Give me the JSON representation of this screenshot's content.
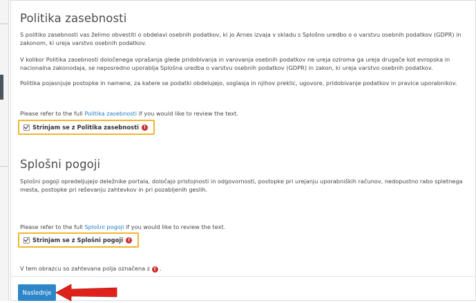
{
  "privacy": {
    "title": "Politika zasebnosti",
    "para1": "S politiko zasebnosti vas želimo obvestiti o obdelavi osebnih podatkov, ki jo Arnes izvaja v skladu s Splošno uredbo o o varstvu osebnih podatkov (GDPR) in zakonom, ki ureja varstvo osebnih podatkov.",
    "para2": "V kolikor Politika zasebnosti določenega vprašanja glede pridobivanja in varovanja osebnih podatkov ne ureja oziroma ga ureja drugače kot evropska in nacionalna zakonodaja, se neposredno uporablja Splošna uredba o varstvu osebnih podatkov (GDPR) in zakon, ki ureja varstvo osebnih podatkov.",
    "para3": "Politika pojasnjuje postopke in namene, za katere se podatki obdelujejo, soglasja in njihov preklic, ugovore, pridobivanje podatkov in pravice uporabnikov.",
    "refer_prefix": "Please refer to the full ",
    "refer_link": "Politika zasebnosti",
    "refer_suffix": " if you would like to review the text.",
    "consent_label": "Strinjam se z Politika zasebnosti",
    "consent_checked": true
  },
  "terms": {
    "title": "Splošni pogoji",
    "para1": "Splošni pogoji opredeljujejo deležnike portala, določajo pristojnosti in odgovornosti, postopke pri urejanju uporabniških računov, nedopustno rabo spletnega mesta, postopke pri reševanju zahtevkov in pri pozabljenih geslih.",
    "refer_prefix": "Please refer to the full ",
    "refer_link": "Splošni pogoji",
    "refer_suffix": " if you would like to review the text.",
    "consent_label": "Strinjam se z Splošni pogoji",
    "consent_checked": true
  },
  "required_note_prefix": "V tem obrazcu so zahtevana polja označena z",
  "required_note_suffix": " .",
  "required_icon_glyph": "!",
  "next_button_label": "Naslednje",
  "colors": {
    "highlight_border": "#f0b52c",
    "button": "#2e86c9",
    "link": "#1f7cc1",
    "required_icon": "#c9302c",
    "arrow": "#e0211b"
  },
  "icons": {
    "required": "exclamation-circle-icon",
    "annotation": "red-arrow-icon"
  }
}
